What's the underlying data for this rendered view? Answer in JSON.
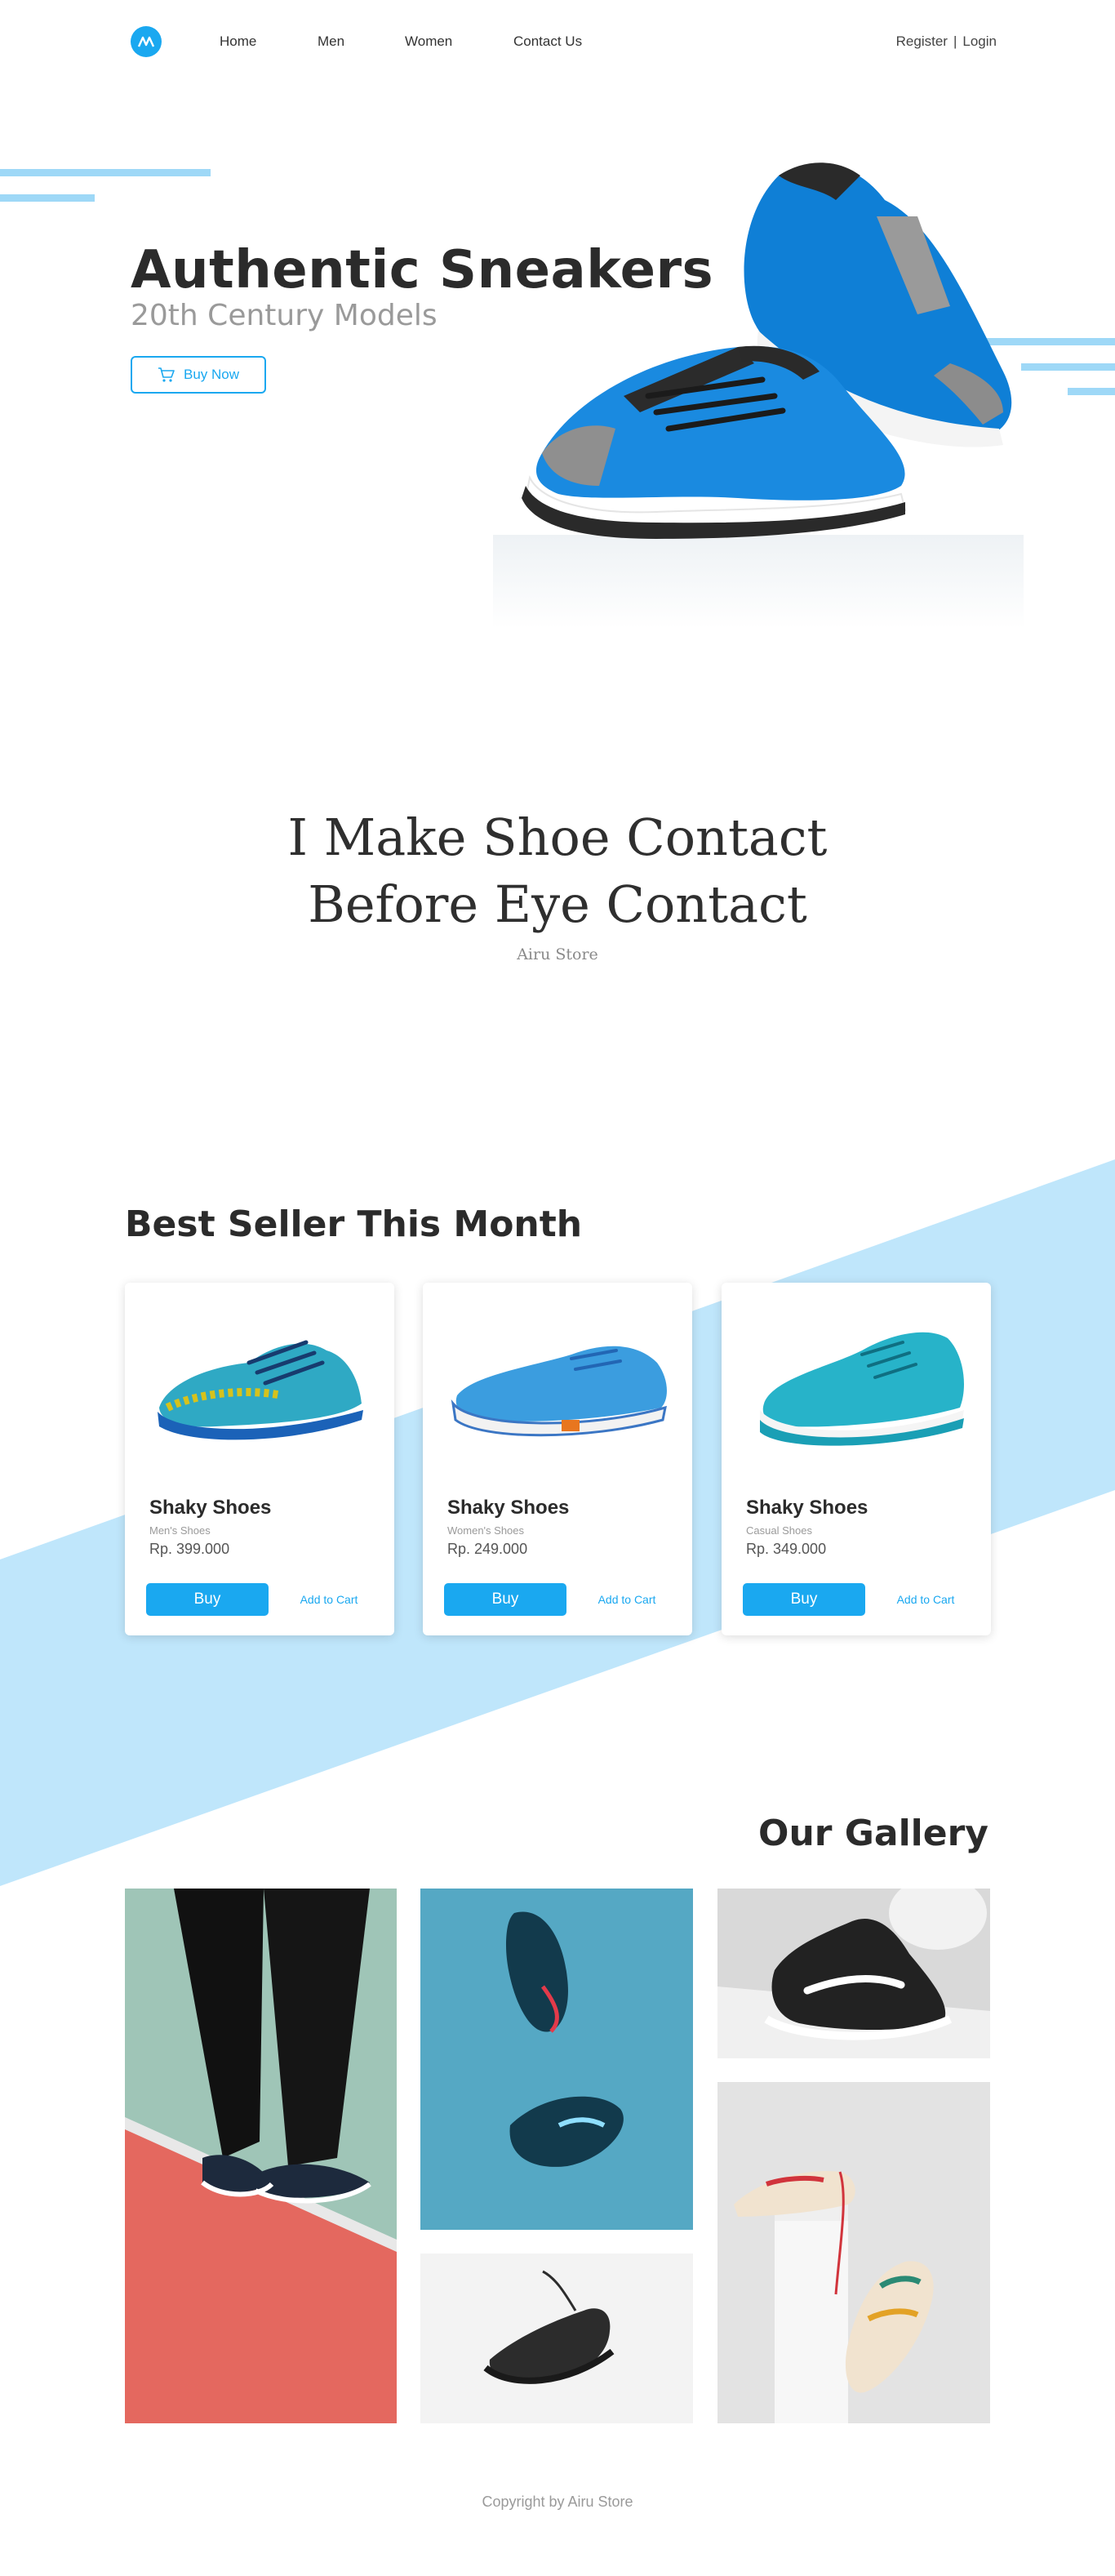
{
  "nav": {
    "logo_icon": "airu-logo-icon",
    "links": [
      "Home",
      "Men",
      "Women",
      "Contact Us"
    ],
    "register": "Register",
    "separator": "|",
    "login": "Login"
  },
  "hero": {
    "title": "Authentic Sneakers",
    "subtitle": "20th Century Models",
    "button_label": "Buy Now",
    "button_icon": "cart-icon"
  },
  "quote": {
    "line1": "I Make Shoe Contact",
    "line2": "Before Eye Contact",
    "author": "Airu Store"
  },
  "best_seller": {
    "title": "Best Seller This Month",
    "products": [
      {
        "name": "Shaky Shoes",
        "category": "Men's Shoes",
        "price": "Rp. 399.000",
        "buy": "Buy",
        "cart": "Add to Cart"
      },
      {
        "name": "Shaky Shoes",
        "category": "Women's Shoes",
        "price": "Rp. 249.000",
        "buy": "Buy",
        "cart": "Add to Cart"
      },
      {
        "name": "Shaky Shoes",
        "category": "Casual Shoes",
        "price": "Rp. 349.000",
        "buy": "Buy",
        "cart": "Add to Cart"
      }
    ]
  },
  "gallery": {
    "title": "Our Gallery"
  },
  "footer": {
    "copyright": "Copyright by Airu Store"
  },
  "colors": {
    "accent": "#1aa8f0",
    "band": "#bfe6fb",
    "deco": "#9ed8f7",
    "heading": "#2b2b2b"
  }
}
